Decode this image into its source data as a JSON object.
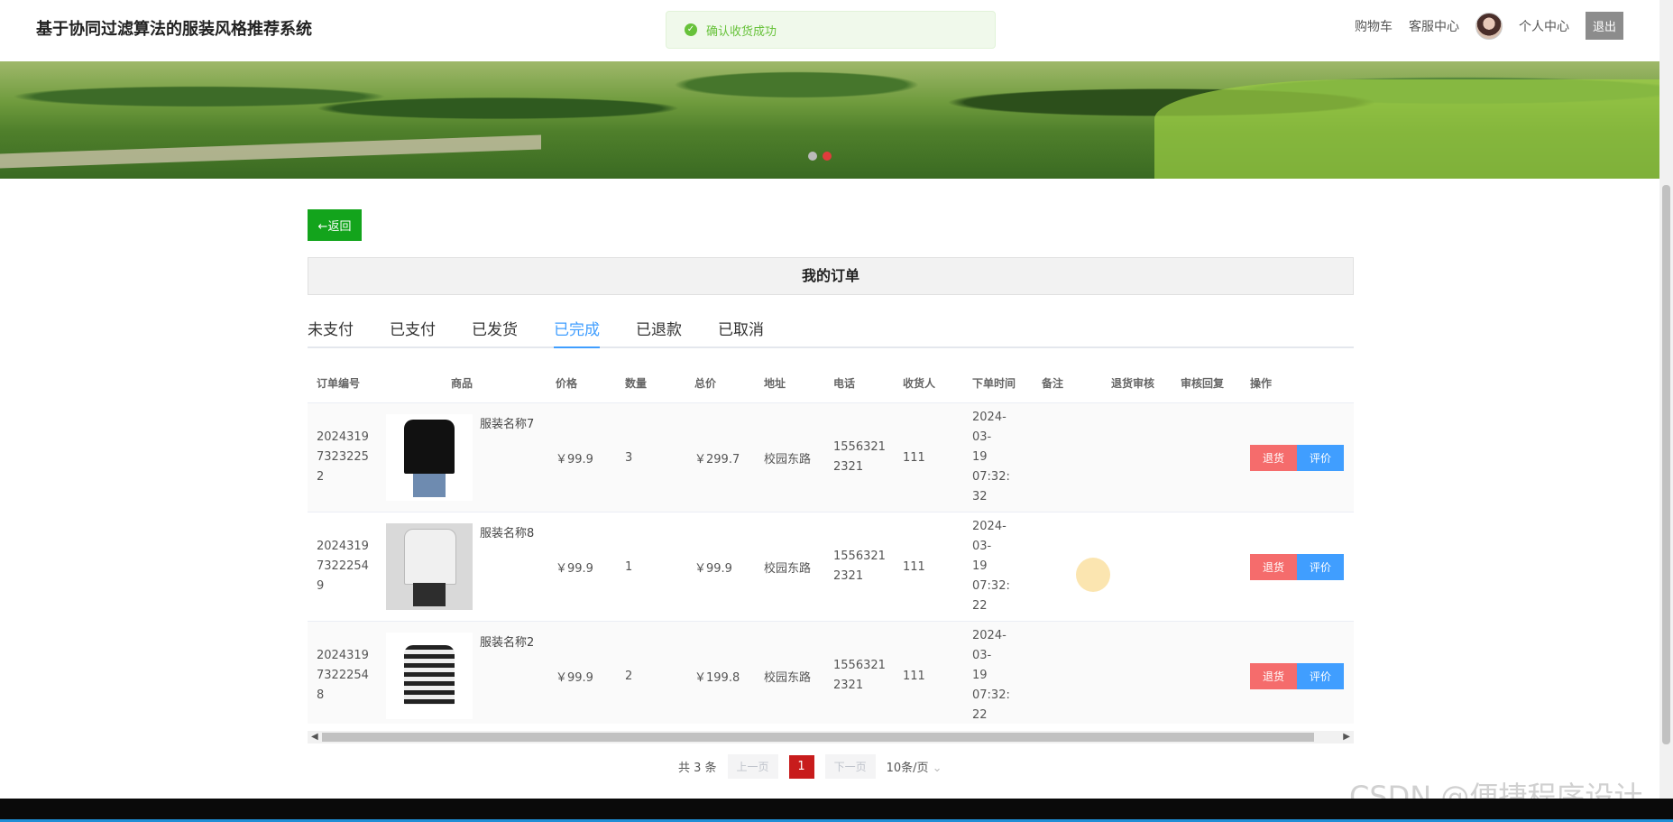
{
  "site": {
    "title": "基于协同过滤算法的服装风格推荐系统"
  },
  "nav": {
    "cart": "购物车",
    "service": "客服中心",
    "profile": "个人中心",
    "logout": "退出"
  },
  "toast": {
    "message": "确认收货成功",
    "icon": "success-check-icon",
    "color": "#67c23a"
  },
  "back_button": {
    "label": "←返回"
  },
  "panel": {
    "title": "我的订单"
  },
  "tabs": [
    {
      "label": "未支付",
      "active": false
    },
    {
      "label": "已支付",
      "active": false
    },
    {
      "label": "已发货",
      "active": false
    },
    {
      "label": "已完成",
      "active": true
    },
    {
      "label": "已退款",
      "active": false
    },
    {
      "label": "已取消",
      "active": false
    }
  ],
  "table": {
    "headers": [
      "订单编号",
      "商品",
      "价格",
      "数量",
      "总价",
      "地址",
      "电话",
      "收货人",
      "下单时间",
      "备注",
      "退货审核",
      "审核回复",
      "操作"
    ],
    "rows": [
      {
        "order_no": "20243197323225 2",
        "order_no_display": "2024319\n7323225\n2",
        "goods": "服装名称7",
        "price": "￥99.9",
        "qty": "3",
        "total": "￥299.7",
        "address": "校园东路",
        "phone": "1556321\n2321",
        "receiver": "111",
        "time": "2024-03-\n19 07:32:\n32",
        "remark": "",
        "review": "",
        "reply": "",
        "btn_return": "退货",
        "btn_review": "评价"
      },
      {
        "order_no": "20243197322254 9",
        "order_no_display": "2024319\n7322254\n9",
        "goods": "服装名称8",
        "price": "￥99.9",
        "qty": "1",
        "total": "￥99.9",
        "address": "校园东路",
        "phone": "1556321\n2321",
        "receiver": "111",
        "time": "2024-03-\n19 07:32:\n22",
        "remark": "",
        "review": "",
        "reply": "",
        "btn_return": "退货",
        "btn_review": "评价"
      },
      {
        "order_no": "20243197322254 8",
        "order_no_display": "2024319\n7322254\n8",
        "goods": "服装名称2",
        "price": "￥99.9",
        "qty": "2",
        "total": "￥199.8",
        "address": "校园东路",
        "phone": "1556321\n2321",
        "receiver": "111",
        "time": "2024-03-\n19 07:32:\n22",
        "remark": "",
        "review": "",
        "reply": "",
        "btn_return": "退货",
        "btn_review": "评价"
      }
    ]
  },
  "pagination": {
    "total": "共 3 条",
    "prev": "上一页",
    "current": "1",
    "next": "下一页",
    "page_size": "10条/页"
  },
  "watermark": "CSDN @便捷程序设计",
  "colors": {
    "accent": "#409eff",
    "back": "#13a41c",
    "danger": "#f56c6c",
    "page_active": "#c81c1c"
  }
}
